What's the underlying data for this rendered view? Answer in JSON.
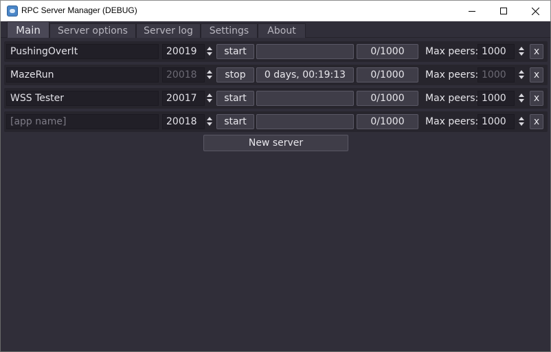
{
  "window": {
    "title": "RPC Server Manager (DEBUG)",
    "icon": "app-icon"
  },
  "tabs": [
    {
      "label": "Main",
      "active": true
    },
    {
      "label": "Server options",
      "active": false
    },
    {
      "label": "Server log",
      "active": false
    },
    {
      "label": "Settings",
      "active": false
    },
    {
      "label": "About",
      "active": false
    }
  ],
  "servers": [
    {
      "app_name": "PushingOverIt",
      "port": "20019",
      "action": "start",
      "status": "",
      "peers": "0/1000",
      "max_peers_label": "Max peers:",
      "max_peers": "1000",
      "remove": "x",
      "running": false
    },
    {
      "app_name": "MazeRun",
      "port": "20018",
      "action": "stop",
      "status": "0 days, 00:19:13",
      "peers": "0/1000",
      "max_peers_label": "Max peers:",
      "max_peers": "1000",
      "remove": "x",
      "running": true
    },
    {
      "app_name": "WSS Tester",
      "port": "20017",
      "action": "start",
      "status": "",
      "peers": "0/1000",
      "max_peers_label": "Max peers:",
      "max_peers": "1000",
      "remove": "x",
      "running": false
    },
    {
      "app_name": "",
      "app_name_placeholder": "[app name]",
      "port": "20018",
      "action": "start",
      "status": "",
      "peers": "0/1000",
      "max_peers_label": "Max peers:",
      "max_peers": "1000",
      "remove": "x",
      "running": false
    }
  ],
  "new_server_label": "New server",
  "colors": {
    "background": "#302e39",
    "row": "#27252d",
    "field": "#211f27",
    "button": "#3f3d48",
    "text": "#e6e5ea"
  }
}
